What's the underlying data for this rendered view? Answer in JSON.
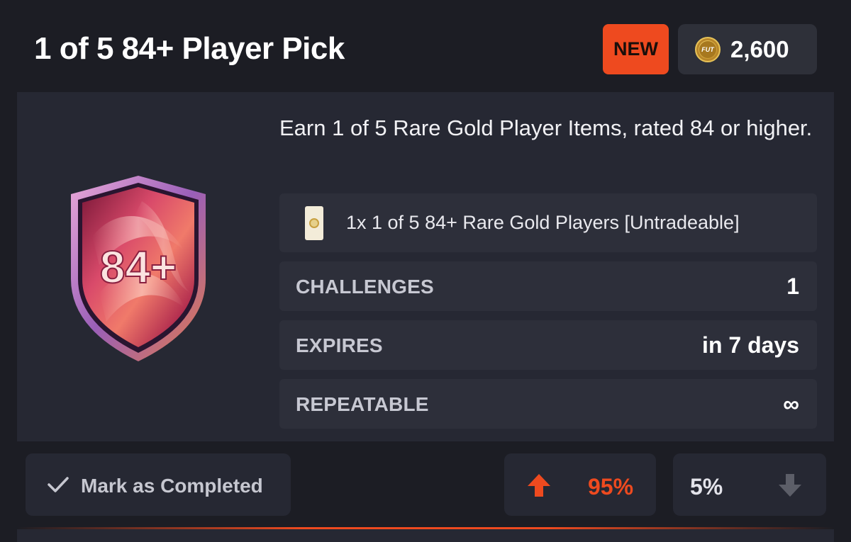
{
  "header": {
    "title": "1 of 5 84+ Player Pick",
    "badge": "NEW",
    "coin_icon_text": "FUT",
    "price": "2,600"
  },
  "pack": {
    "rating_badge": "84+",
    "description": "Earn 1 of 5 Rare Gold Player Items, rated 84 or higher.",
    "reward": "1x 1 of 5 84+ Rare Gold Players [Untradeable]"
  },
  "stats": [
    {
      "label": "CHALLENGES",
      "value": "1"
    },
    {
      "label": "EXPIRES",
      "value": "in 7 days"
    },
    {
      "label": "REPEATABLE",
      "value": "∞"
    }
  ],
  "footer": {
    "mark_label": "Mark as Completed",
    "upvote_pct": "95%",
    "downvote_pct": "5%"
  },
  "colors": {
    "accent": "#ee4a1f",
    "background": "#1c1d24",
    "panel": "#262833",
    "row": "#2d2f3a"
  }
}
